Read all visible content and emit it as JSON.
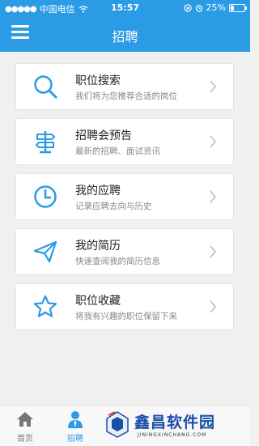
{
  "status_bar": {
    "carrier": "中国电信",
    "time": "15:57",
    "battery": "25%",
    "battery_level": 0.25
  },
  "header": {
    "title": "招聘",
    "menu_icon": "hamburger-icon"
  },
  "menu": [
    {
      "title": "职位搜索",
      "subtitle": "我们将为您推荐合适的岗位",
      "icon": "search-icon"
    },
    {
      "title": "招聘会预告",
      "subtitle": "最新的招聘、面试资讯",
      "icon": "signpost-icon"
    },
    {
      "title": "我的应聘",
      "subtitle": "记录应聘去向与历史",
      "icon": "clock-icon"
    },
    {
      "title": "我的简历",
      "subtitle": "快速查阅我的简历信息",
      "icon": "paper-plane-icon"
    },
    {
      "title": "职位收藏",
      "subtitle": "将我有兴趣的职位保留下来",
      "icon": "star-icon"
    }
  ],
  "tabs": [
    {
      "label": "首页",
      "icon": "home-icon",
      "active": false
    },
    {
      "label": "招聘",
      "icon": "person-icon",
      "active": true
    }
  ],
  "watermark": {
    "name": "鑫昌软件园",
    "url": "JININGXINCHANG.COM"
  },
  "colors": {
    "accent": "#2b9be6",
    "icon": "#2b9be6",
    "background": "#f0f0f0"
  }
}
